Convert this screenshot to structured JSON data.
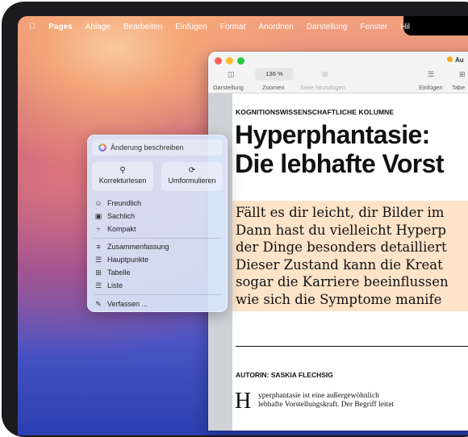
{
  "menubar": {
    "app": "Pages",
    "items": [
      "Ablage",
      "Bearbeiten",
      "Einfügen",
      "Format",
      "Anordnen",
      "Darstellung",
      "Fenster",
      "Hil"
    ]
  },
  "window": {
    "doc_tab": "Au",
    "toolbar": {
      "view_label": "Darstellung",
      "zoom_value": "136 %",
      "zoom_label": "Zoomen",
      "add_page_label": "Seite hinzufügen",
      "insert_label": "Einfügen",
      "table_label": "Tabe"
    },
    "colors": {
      "close": "#ff5f57",
      "minimize": "#febc2e",
      "zoom": "#28c840"
    }
  },
  "document": {
    "kicker": "KOGNITIONSWISSENSCHAFTLICHE KOLUMNE",
    "headline": [
      "Hyperphantasie:",
      "Die lebhafte Vorst"
    ],
    "lead": [
      "Fällt es dir leicht, dir Bilder im",
      "Dann hast du vielleicht Hyperp",
      "der Dinge besonders detailliert",
      "Dieser Zustand kann die Kreat",
      "sogar die Karriere beeinflussen",
      "wie sich die Symptome manife"
    ],
    "author": "AUTORIN: SASKIA FLECHSIG",
    "dropcap": "H",
    "body": [
      "yperphantasie ist eine außergewöhnlich",
      "lebhafte Vorstellungskraft. Der Begriff leitet"
    ]
  },
  "writing_tools": {
    "input_placeholder": "Änderung beschreiben",
    "proofread": "Korrekturlesen",
    "rewrite": "Umformulieren",
    "tones": [
      "Freundlich",
      "Sachlich",
      "Kompakt"
    ],
    "formats": [
      "Zusammenfassung",
      "Hauptpunkte",
      "Tabelle",
      "Liste"
    ],
    "compose": "Verfassen ..."
  }
}
